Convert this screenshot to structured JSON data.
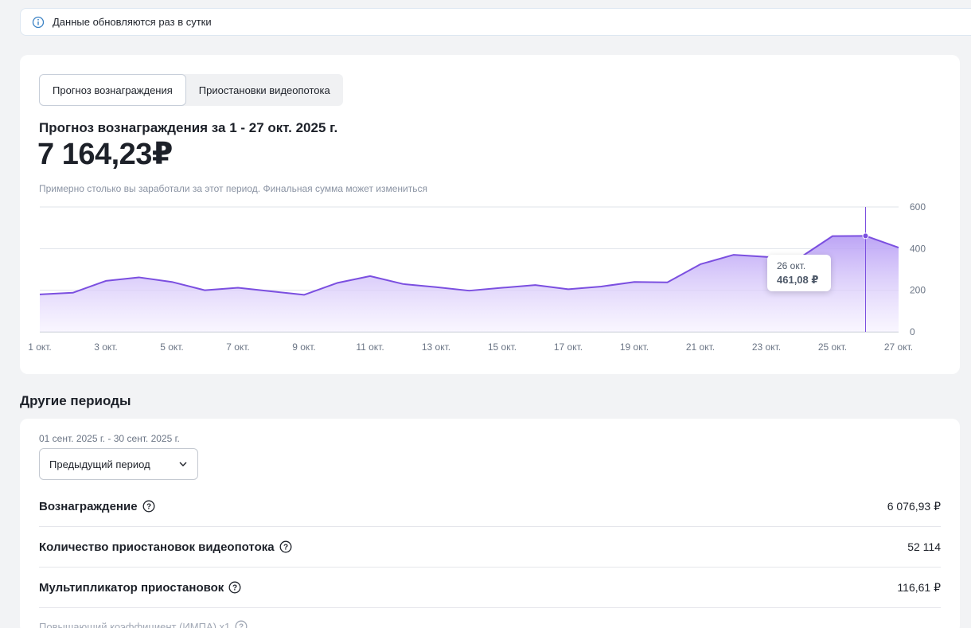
{
  "notice": {
    "text": "Данные обновляются раз в сутки",
    "icon": "info-icon"
  },
  "tabs": [
    {
      "label": "Прогноз вознаграждения",
      "active": true
    },
    {
      "label": "Приостановки видеопотока",
      "active": false
    }
  ],
  "forecast": {
    "title": "Прогноз вознаграждения за 1 - 27 окт. 2025 г.",
    "amount": "7 164,23₽",
    "note": "Примерно столько вы заработали за этот период. Финальная сумма может измениться"
  },
  "tooltip": {
    "date": "26 окт.",
    "value": "461,08 ₽"
  },
  "colors": {
    "line": "#7b4fe0",
    "fill_top": "#b9a0f5",
    "fill_bottom": "#f5f0ff",
    "grid": "#dfe3ea"
  },
  "chart_data": {
    "type": "area",
    "x": [
      "1 окт.",
      "2 окт.",
      "3 окт.",
      "4 окт.",
      "5 окт.",
      "6 окт.",
      "7 окт.",
      "8 окт.",
      "9 окт.",
      "10 окт.",
      "11 окт.",
      "12 окт.",
      "13 окт.",
      "14 окт.",
      "15 окт.",
      "16 окт.",
      "17 окт.",
      "18 окт.",
      "19 окт.",
      "20 окт.",
      "21 окт.",
      "22 окт.",
      "23 окт.",
      "24 окт.",
      "25 окт.",
      "26 окт.",
      "27 окт."
    ],
    "x_tick_labels": [
      "1 окт.",
      "3 окт.",
      "5 окт.",
      "7 окт.",
      "9 окт.",
      "11 окт.",
      "13 окт.",
      "15 окт.",
      "17 окт.",
      "19 окт.",
      "21 окт.",
      "23 окт.",
      "25 окт.",
      "27 окт."
    ],
    "values": [
      180,
      188,
      245,
      262,
      240,
      200,
      212,
      195,
      178,
      235,
      268,
      230,
      215,
      198,
      212,
      225,
      205,
      218,
      240,
      238,
      325,
      370,
      360,
      355,
      460,
      461.08,
      405
    ],
    "y_ticks": [
      0,
      200,
      400,
      600
    ],
    "ylim": [
      0,
      600
    ],
    "highlight_index": 25,
    "grid": true
  },
  "other_periods": {
    "title": "Другие периоды",
    "range": "01 сент. 2025 г. - 30 сент. 2025 г.",
    "select_value": "Предыдущий период",
    "rows": [
      {
        "label": "Вознаграждение",
        "value": "6 076,93 ₽"
      },
      {
        "label": "Количество приостановок видеопотока",
        "value": "52 114"
      },
      {
        "label": "Мультипликатор приостановок",
        "value": "116,61 ₽"
      }
    ],
    "faded_row": "Повышающий коэффициент (ИМПА) x1"
  }
}
